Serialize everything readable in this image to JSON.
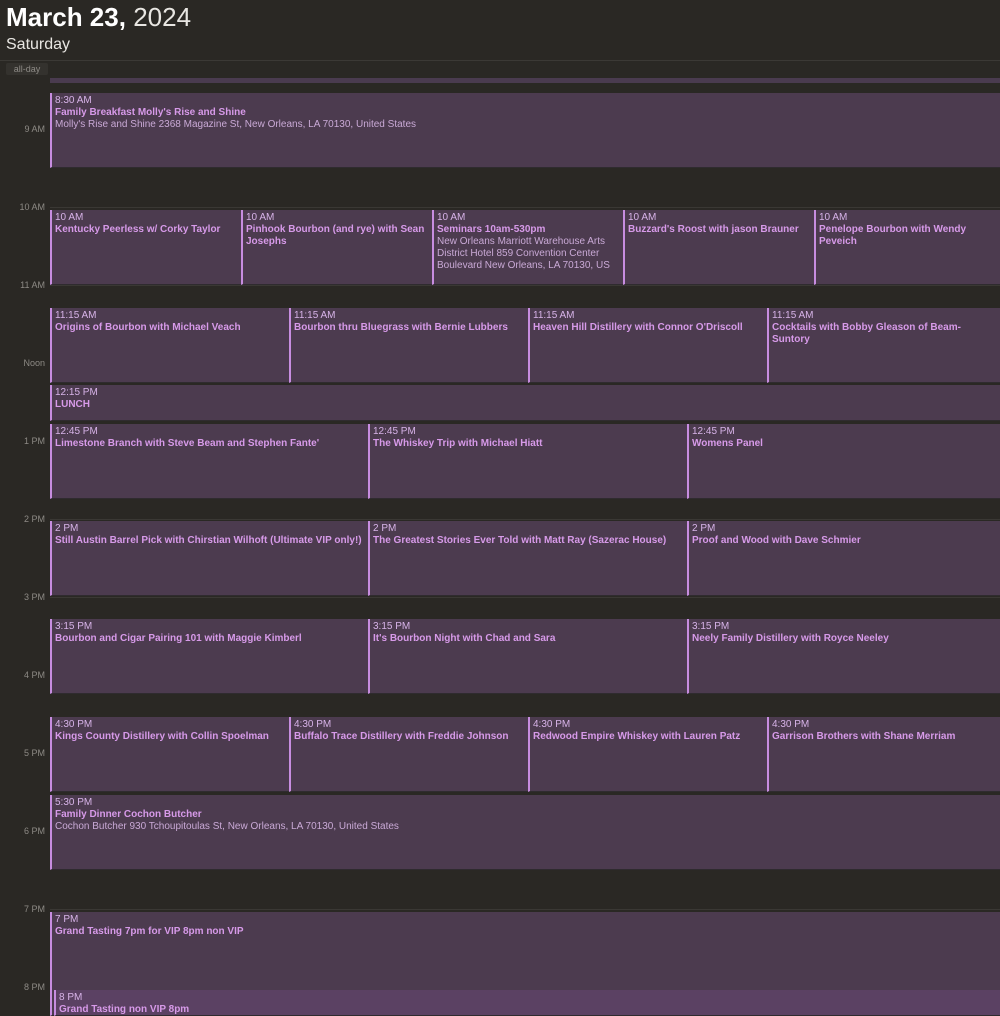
{
  "header": {
    "month_day": "March 23,",
    "year": "2024",
    "weekday": "Saturday"
  },
  "allday": {
    "label": "all-day"
  },
  "hours": [
    "9 AM",
    "10 AM",
    "11 AM",
    "Noon",
    "1 PM",
    "2 PM",
    "3 PM",
    "4 PM",
    "5 PM",
    "6 PM",
    "7 PM",
    "8 PM"
  ],
  "events": [
    {
      "time": "8:30 AM",
      "title": "Family Breakfast Molly's Rise and Shine",
      "location": "Molly's Rise and Shine 2368 Magazine St, New Orleans, LA  70130, United States"
    },
    {
      "time": "10 AM",
      "title": "Kentucky Peerless w/ Corky Taylor",
      "location": ""
    },
    {
      "time": "10 AM",
      "title": "Pinhook Bourbon (and rye) with Sean Josephs",
      "location": ""
    },
    {
      "time": "10 AM",
      "title": "Seminars 10am-530pm",
      "location": "New Orleans Marriott Warehouse Arts District Hotel 859 Convention Center Boulevard New Orleans, LA 70130, US"
    },
    {
      "time": "10 AM",
      "title": "Buzzard's Roost with jason Brauner",
      "location": ""
    },
    {
      "time": "10 AM",
      "title": "Penelope Bourbon with Wendy Peveich",
      "location": ""
    },
    {
      "time": "11:15 AM",
      "title": "Origins of Bourbon with Michael Veach",
      "location": ""
    },
    {
      "time": "11:15 AM",
      "title": "Bourbon thru Bluegrass with Bernie Lubbers",
      "location": ""
    },
    {
      "time": "11:15 AM",
      "title": "Heaven Hill Distillery with Connor O'Driscoll",
      "location": ""
    },
    {
      "time": "11:15 AM",
      "title": "Cocktails with Bobby Gleason of Beam-Suntory",
      "location": ""
    },
    {
      "time": "12:15 PM",
      "title": "LUNCH",
      "location": ""
    },
    {
      "time": "12:45 PM",
      "title": "Limestone Branch with Steve Beam and Stephen Fante'",
      "location": ""
    },
    {
      "time": "12:45 PM",
      "title": "The Whiskey Trip with Michael Hiatt",
      "location": ""
    },
    {
      "time": "12:45 PM",
      "title": "Womens Panel",
      "location": ""
    },
    {
      "time": "2 PM",
      "title": "Still Austin Barrel Pick with Chirstian Wilhoft (Ultimate VIP only!)",
      "location": ""
    },
    {
      "time": "2 PM",
      "title": "The Greatest Stories Ever Told with Matt Ray (Sazerac House)",
      "location": ""
    },
    {
      "time": "2 PM",
      "title": "Proof and Wood with Dave Schmier",
      "location": ""
    },
    {
      "time": "3:15 PM",
      "title": "Bourbon and Cigar Pairing 101 with Maggie Kimberl",
      "location": ""
    },
    {
      "time": "3:15 PM",
      "title": "It's Bourbon Night with Chad and Sara",
      "location": ""
    },
    {
      "time": "3:15 PM",
      "title": "Neely Family Distillery with Royce Neeley",
      "location": ""
    },
    {
      "time": "4:30 PM",
      "title": "Kings County Distillery with Collin Spoelman",
      "location": ""
    },
    {
      "time": "4:30 PM",
      "title": "Buffalo Trace Distillery with Freddie Johnson",
      "location": ""
    },
    {
      "time": "4:30 PM",
      "title": "Redwood Empire Whiskey with Lauren Patz",
      "location": ""
    },
    {
      "time": "4:30 PM",
      "title": "Garrison Brothers with Shane Merriam",
      "location": ""
    },
    {
      "time": "5:30 PM",
      "title": "Family Dinner Cochon Butcher",
      "location": "Cochon Butcher 930 Tchoupitoulas St, New Orleans, LA  70130, United States"
    },
    {
      "time": "7 PM",
      "title": "Grand Tasting 7pm for VIP 8pm non VIP",
      "location": ""
    },
    {
      "time": "8 PM",
      "title": "Grand Tasting non VIP 8pm",
      "location": ""
    }
  ],
  "colors": {
    "background": "#2a2824",
    "event_fill": "#4c3b4f",
    "event_accent": "#c78de0",
    "event_title": "#d79ae9"
  }
}
